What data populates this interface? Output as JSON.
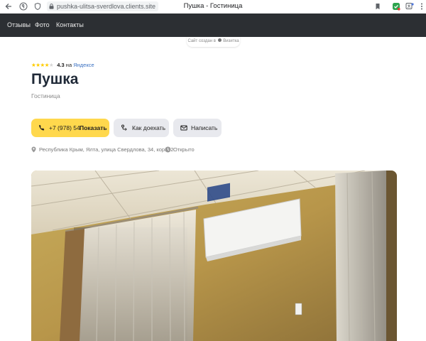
{
  "browser": {
    "url": "pushka-ulitsa-sverdlova.clients.site",
    "tab_title": "Пушка - Гостиница"
  },
  "nav": {
    "items": [
      "Отзывы",
      "Фото",
      "Контакты"
    ]
  },
  "badge": {
    "text_pre": "Сайт создан в",
    "text_brand": "Визитка"
  },
  "rating": {
    "value": "4.3",
    "on_text": "на",
    "source": "Яндексе",
    "stars_filled": 4,
    "stars_total": 5
  },
  "business": {
    "name": "Пушка",
    "category": "Гостиница"
  },
  "actions": {
    "phone_visible": "+7 (978) 54",
    "phone_hidden_tail": "",
    "show_label": "Показать",
    "route_label": "Как доехать",
    "write_label": "Написать"
  },
  "info": {
    "address": "Республика Крым, Ялта, улица Свердлова, 34, корп. 2",
    "status": "Открыто"
  },
  "colors": {
    "accent": "#ffd84d",
    "nav_bg": "#2c2f33",
    "link": "#3a71c2"
  },
  "photo": {
    "icons": [
      "air-conditioner",
      "curtains",
      "remote"
    ]
  }
}
